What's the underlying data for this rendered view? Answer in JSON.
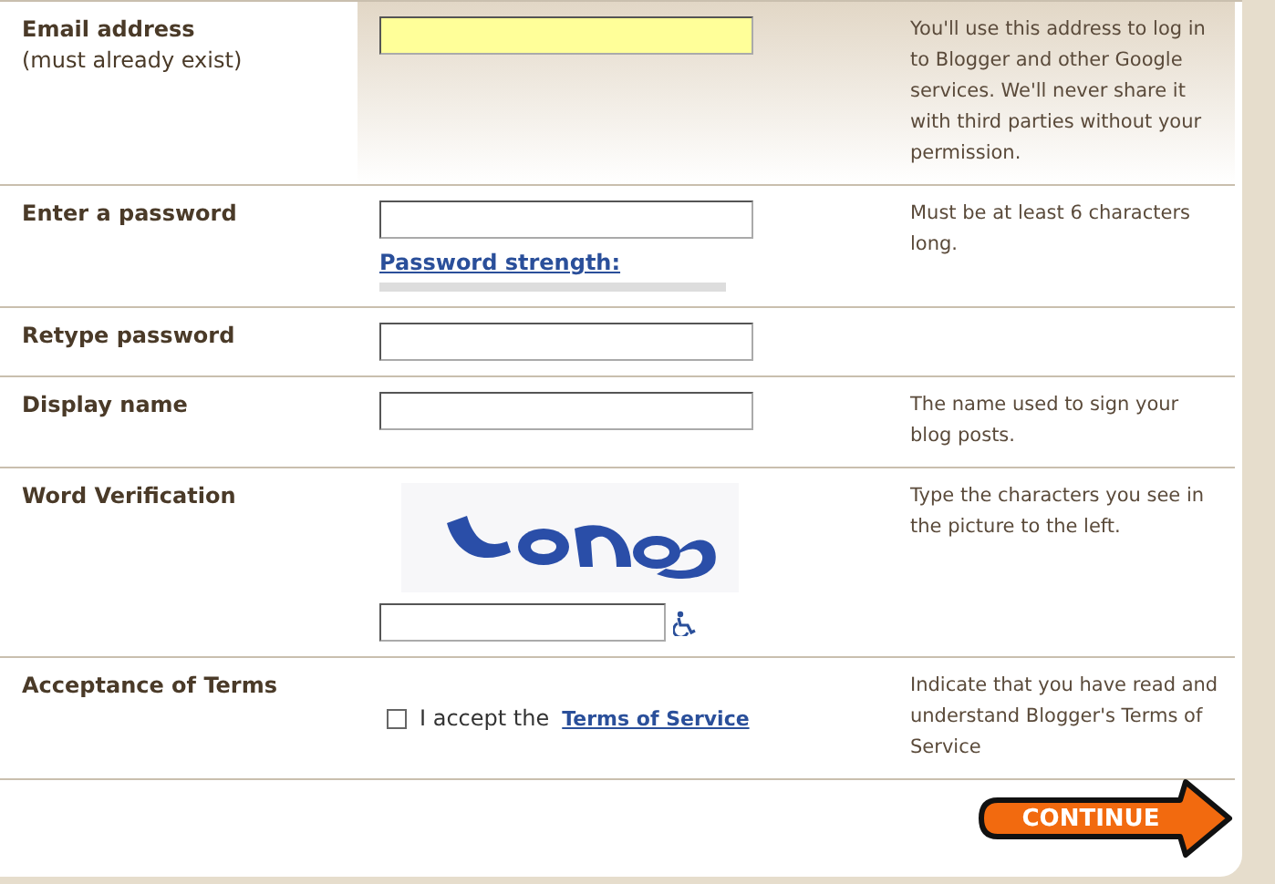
{
  "rows": [
    {
      "kind": "text",
      "label": "Email address",
      "sublabel": "(must already exist)",
      "highlighted": true,
      "hint": "You'll use this address to log in to Blogger and other Google services. We'll never share it with third parties without your permission."
    },
    {
      "kind": "password",
      "label": "Enter a password",
      "highlighted": false,
      "strength_link": "Password strength:",
      "hint": "Must be at least 6 characters long."
    },
    {
      "kind": "text",
      "label": "Retype password",
      "highlighted": false
    },
    {
      "kind": "text",
      "label": "Display name",
      "highlighted": false,
      "hint": "The name used to sign your blog posts."
    },
    {
      "kind": "captcha",
      "label": "Word Verification",
      "highlighted": false,
      "hint": "Type the characters you see in the picture to the left."
    },
    {
      "kind": "terms",
      "label": "Acceptance of Terms",
      "checked": false,
      "accept_text": "I accept the",
      "link": "Terms of Service",
      "hint": "Indicate that you have read and understand Blogger's Terms of Service"
    }
  ],
  "continue_button": "CONTINUE"
}
